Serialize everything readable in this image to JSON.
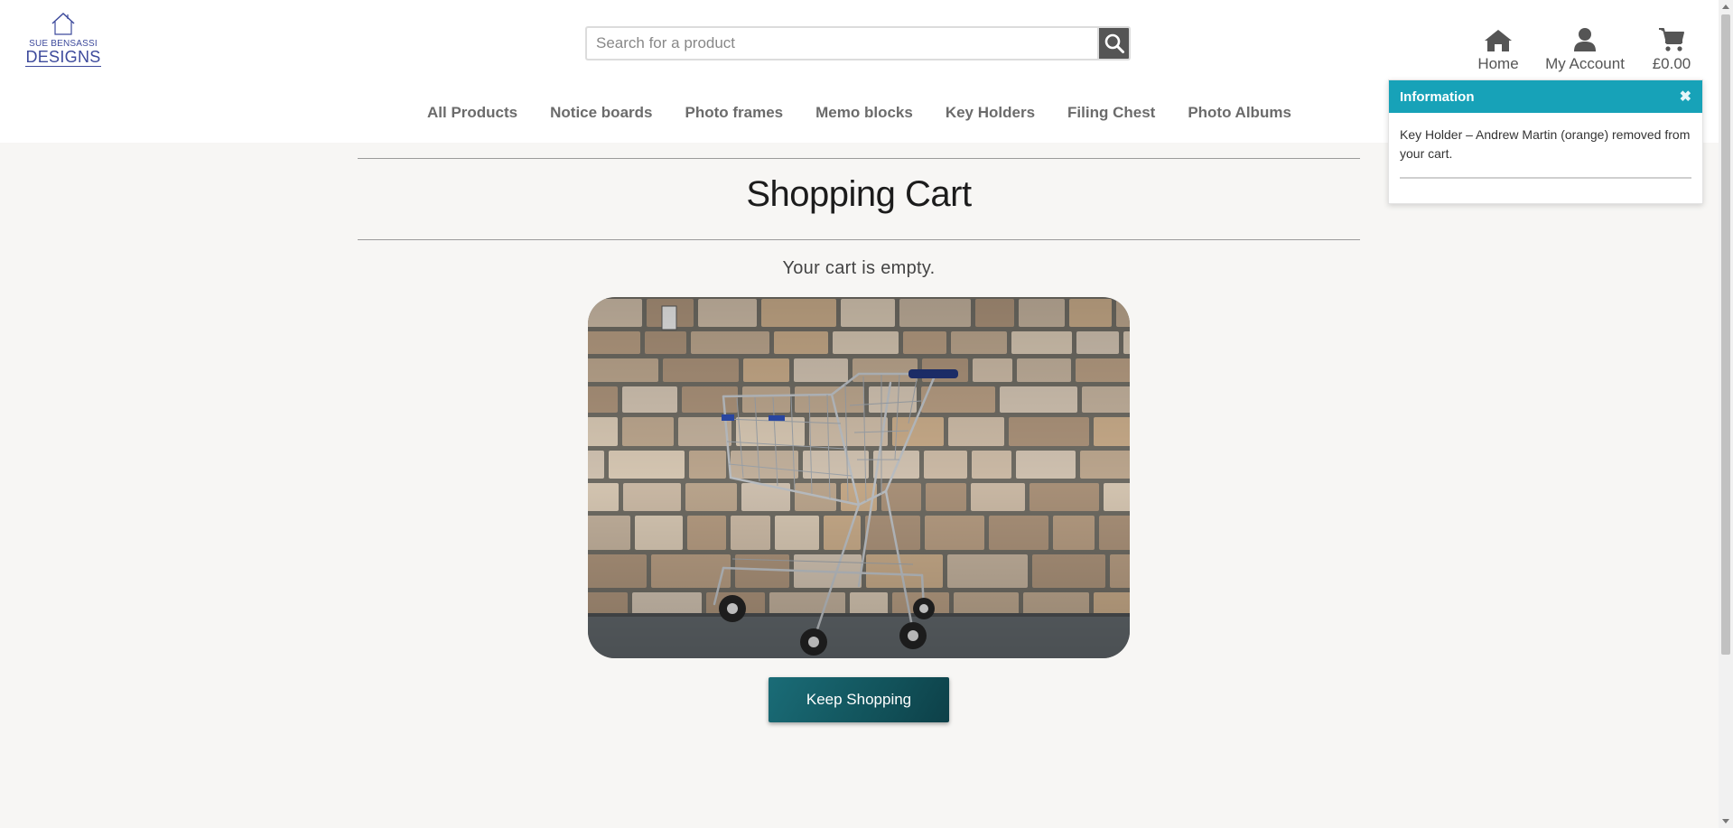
{
  "logo": {
    "top_text": "SUE BENSASSI",
    "main_text": "DESIGNS",
    "icon": "house-logo-icon"
  },
  "search": {
    "placeholder": "Search for a product",
    "value": "",
    "icon": "search-icon"
  },
  "top_links": {
    "home": {
      "label": "Home",
      "icon": "home-icon"
    },
    "account": {
      "label": "My Account",
      "icon": "user-icon"
    },
    "cart": {
      "label": "£0.00",
      "icon": "cart-icon"
    }
  },
  "nav": {
    "items": [
      {
        "label": "All Products"
      },
      {
        "label": "Notice boards"
      },
      {
        "label": "Photo frames"
      },
      {
        "label": "Memo blocks"
      },
      {
        "label": "Key Holders"
      },
      {
        "label": "Filing Chest"
      },
      {
        "label": "Photo Albums"
      }
    ]
  },
  "toast": {
    "title": "Information",
    "close_icon": "close-icon",
    "message": "Key Holder – Andrew Martin (orange) removed from your cart."
  },
  "main": {
    "title": "Shopping Cart",
    "empty_message": "Your cart is empty.",
    "image_alt": "shopping-cart-photo",
    "keep_shopping_label": "Keep Shopping"
  },
  "colors": {
    "toast_header": "#17a2b8",
    "button": "#14555d",
    "logo": "#3d4a9c",
    "background": "#f7f6f4"
  }
}
